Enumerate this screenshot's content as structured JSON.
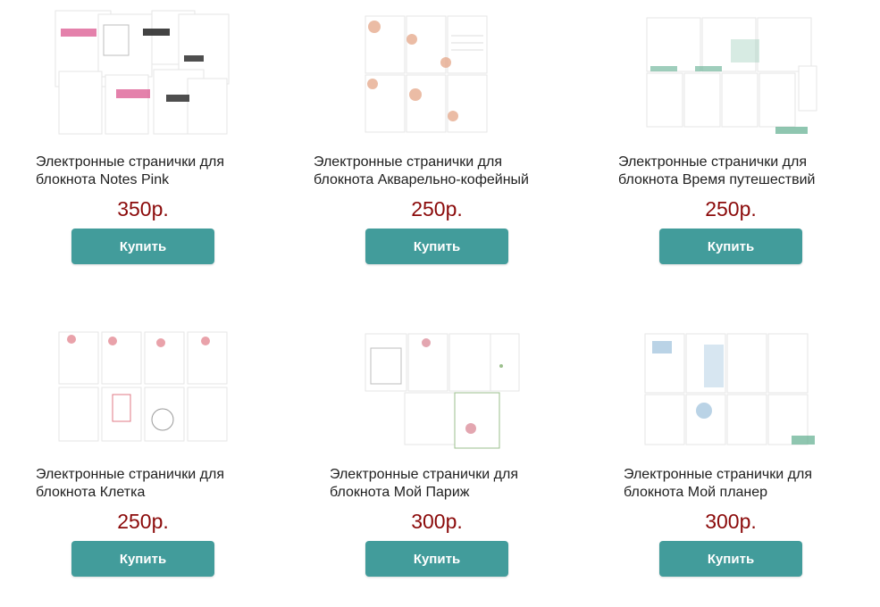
{
  "products": [
    {
      "title_line1": "Электронные странички для",
      "title_line2": "блокнота Notes Pink",
      "price": "350р.",
      "button_label": "Купить",
      "thumb_accent": "#d94b88"
    },
    {
      "title_line1": "Электронные странички для",
      "title_line2": "блокнота Акварельно-кофейный",
      "price": "250р.",
      "button_label": "Купить",
      "thumb_accent": "#e2a07f"
    },
    {
      "title_line1": "Электронные странички для",
      "title_line2": "блокнота Время путешествий",
      "price": "250р.",
      "button_label": "Купить",
      "thumb_accent": "#5fae8f"
    },
    {
      "title_line1": "Электронные странички для",
      "title_line2": "блокнота Клетка",
      "price": "250р.",
      "button_label": "Купить",
      "thumb_accent": "#e07a86"
    },
    {
      "title_line1": "Электронные странички для",
      "title_line2": "блокнота Мой Париж",
      "price": "300р.",
      "button_label": "Купить",
      "thumb_accent": "#9bbf8c"
    },
    {
      "title_line1": "Электронные странички для",
      "title_line2": "блокнота Мой планер",
      "price": "300р.",
      "button_label": "Купить",
      "thumb_accent": "#8cb6d6"
    }
  ]
}
